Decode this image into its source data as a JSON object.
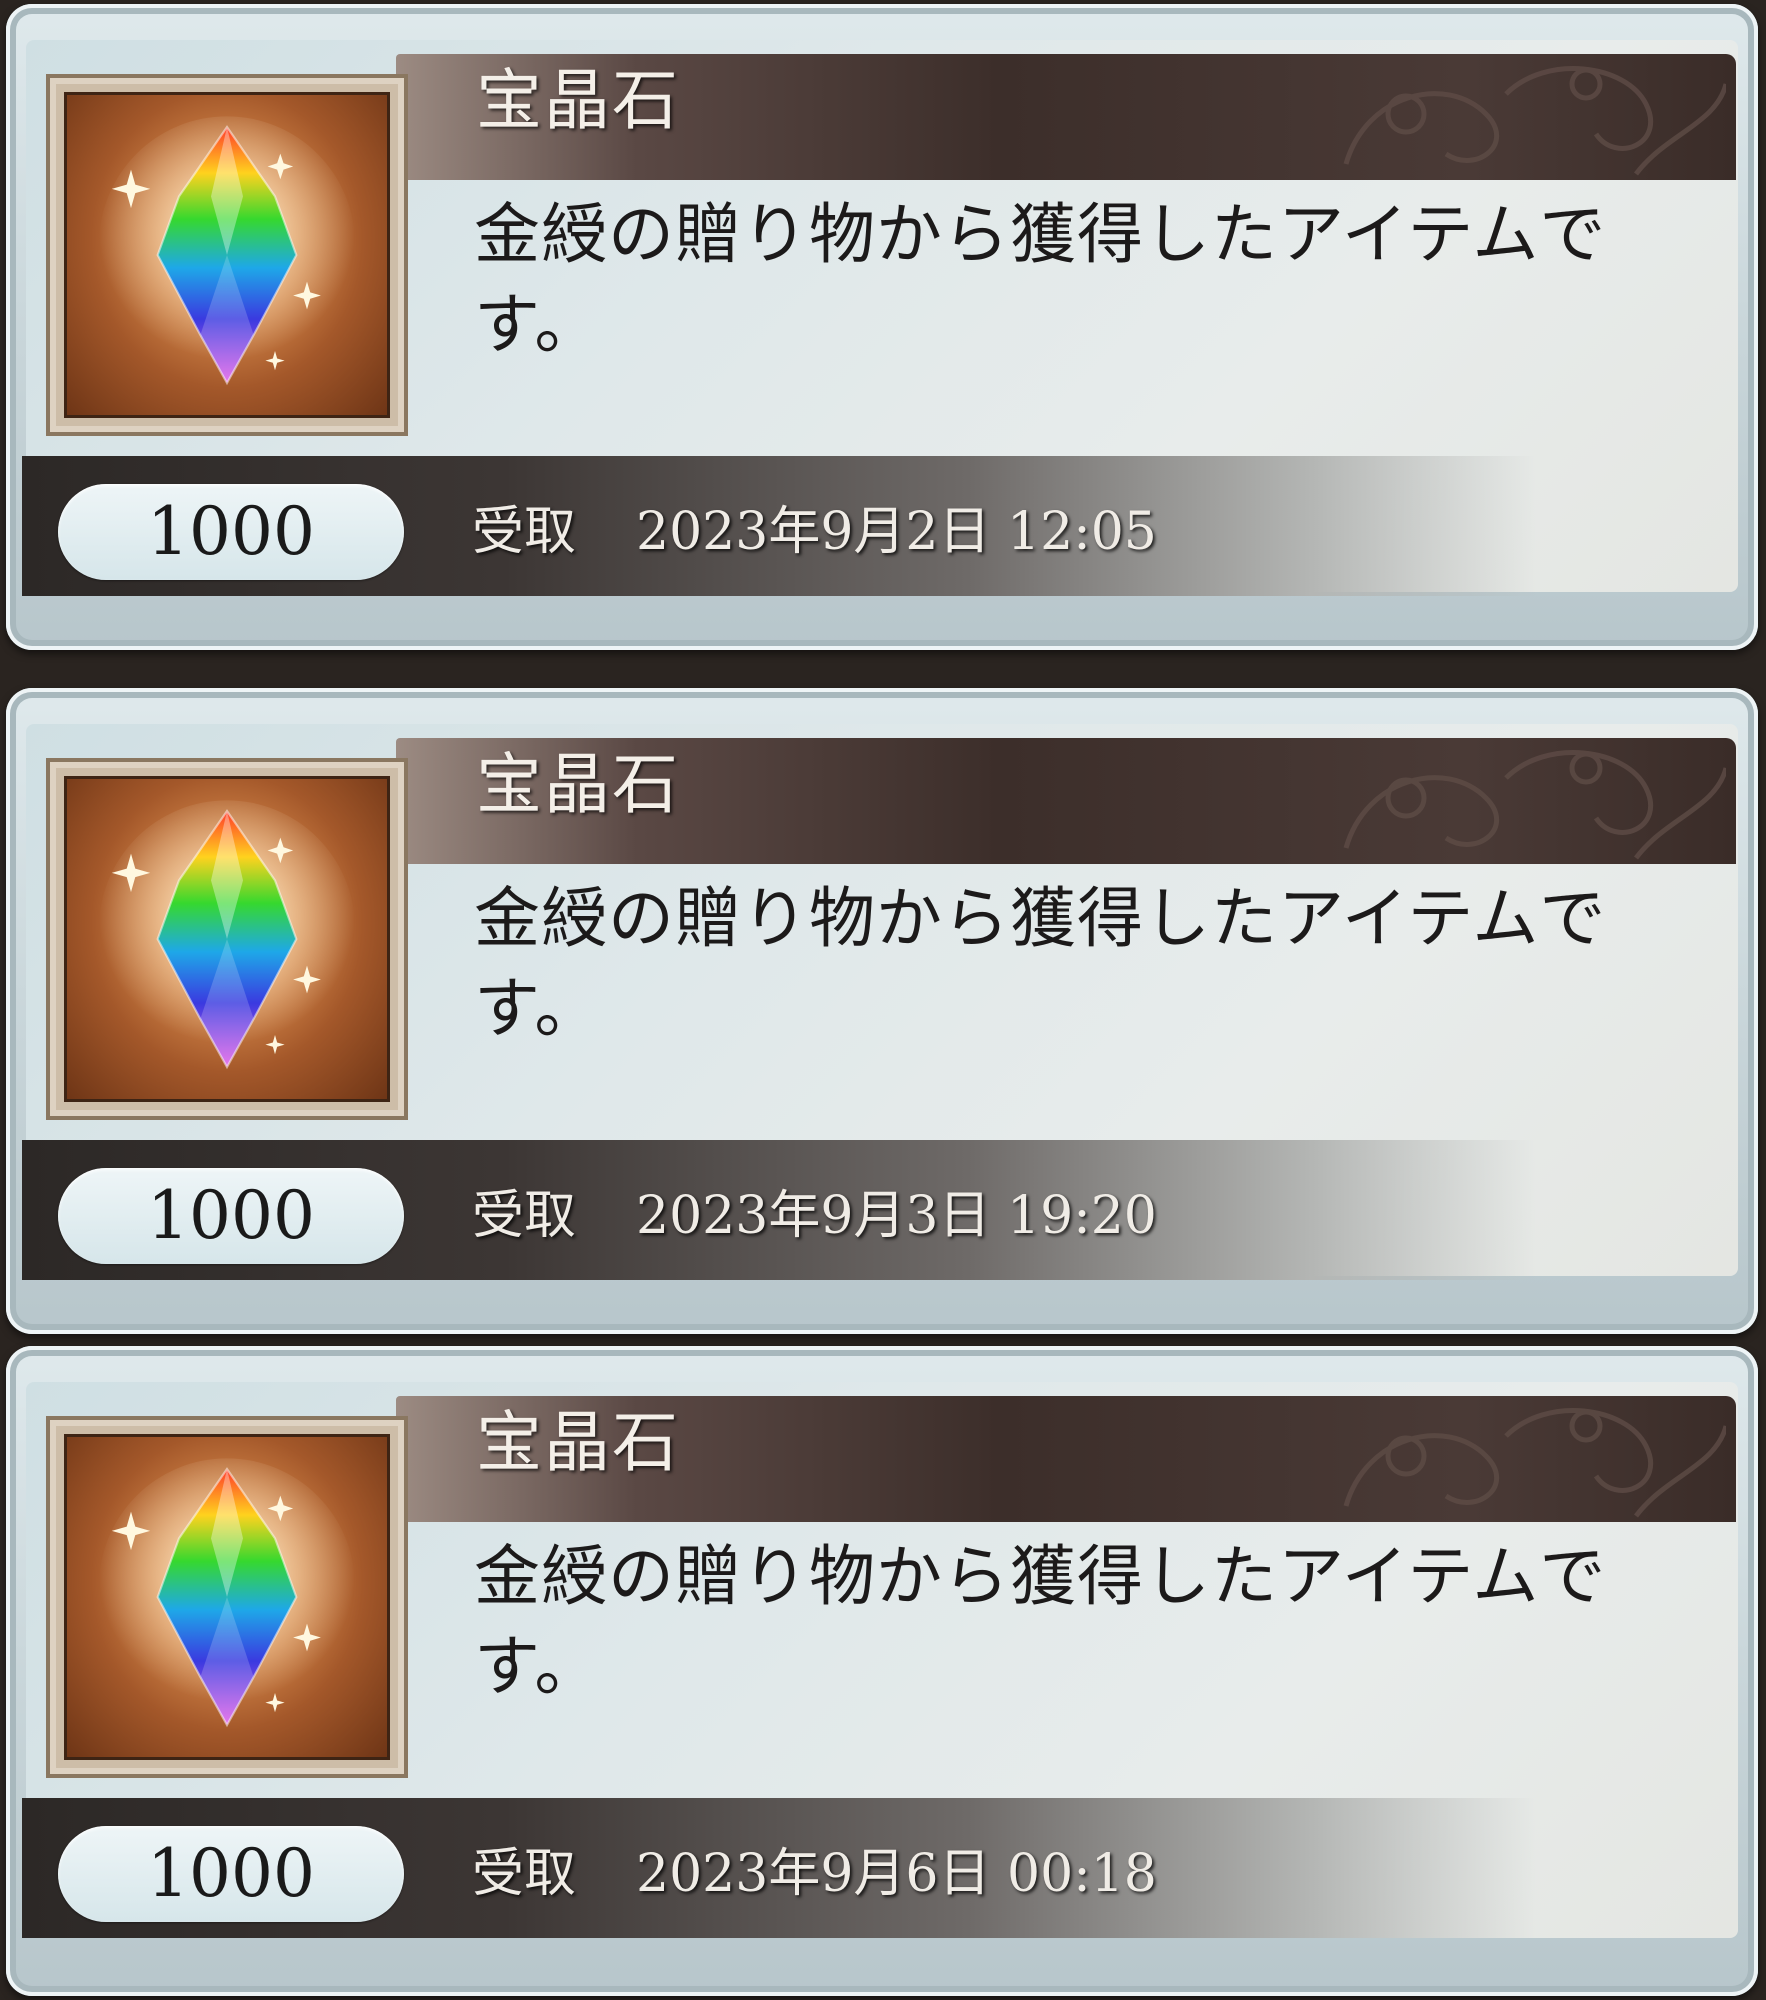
{
  "items": [
    {
      "name": "宝晶石",
      "description": "金綬の贈り物から獲得したアイテムです。",
      "count": "1000",
      "received_label": "受取",
      "received_date": "2023年9月2日 12:05",
      "icon": "rainbow-crystal-icon"
    },
    {
      "name": "宝晶石",
      "description": "金綬の贈り物から獲得したアイテムです。",
      "count": "1000",
      "received_label": "受取",
      "received_date": "2023年9月3日 19:20",
      "icon": "rainbow-crystal-icon"
    },
    {
      "name": "宝晶石",
      "description": "金綬の贈り物から獲得したアイテムです。",
      "count": "1000",
      "received_label": "受取",
      "received_date": "2023年9月6日 00:18",
      "icon": "rainbow-crystal-icon"
    }
  ],
  "colors": {
    "title_bar": "#3c2e2a",
    "card_bg": "#dfe8ea",
    "icon_bg": "#d78a4c"
  }
}
